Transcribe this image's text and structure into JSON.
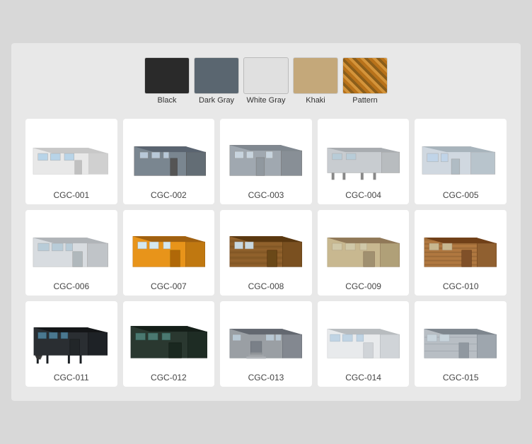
{
  "swatches": [
    {
      "id": "black",
      "label": "Black",
      "class": "c-black"
    },
    {
      "id": "dark-gray",
      "label": "Dark Gray",
      "class": "c-darkgray"
    },
    {
      "id": "white-gray",
      "label": "White Gray",
      "class": "c-whitegray"
    },
    {
      "id": "khaki",
      "label": "Khaki",
      "class": "c-khaki"
    },
    {
      "id": "pattern",
      "label": "Pattern",
      "class": "c-pattern"
    }
  ],
  "products": [
    {
      "id": "CGC-001",
      "label": "CGC-001",
      "color": "light",
      "style": "wide"
    },
    {
      "id": "CGC-002",
      "label": "CGC-002",
      "color": "gray",
      "style": "corner"
    },
    {
      "id": "CGC-003",
      "label": "CGC-003",
      "color": "gray-medium",
      "style": "corner2"
    },
    {
      "id": "CGC-004",
      "label": "CGC-004",
      "color": "gray-light2",
      "style": "elevated"
    },
    {
      "id": "CGC-005",
      "label": "CGC-005",
      "color": "blue-gray",
      "style": "side"
    },
    {
      "id": "CGC-006",
      "label": "CGC-006",
      "color": "light2",
      "style": "wide2"
    },
    {
      "id": "CGC-007",
      "label": "CGC-007",
      "color": "orange",
      "style": "orange"
    },
    {
      "id": "CGC-008",
      "label": "CGC-008",
      "color": "wood",
      "style": "wood"
    },
    {
      "id": "CGC-009",
      "label": "CGC-009",
      "color": "tan",
      "style": "tan"
    },
    {
      "id": "CGC-010",
      "label": "CGC-010",
      "color": "brown",
      "style": "brown"
    },
    {
      "id": "CGC-011",
      "label": "CGC-011",
      "color": "dark",
      "style": "dark"
    },
    {
      "id": "CGC-012",
      "label": "CGC-012",
      "color": "dark-green",
      "style": "dark-green"
    },
    {
      "id": "CGC-013",
      "label": "CGC-013",
      "color": "gray2",
      "style": "stairs"
    },
    {
      "id": "CGC-014",
      "label": "CGC-014",
      "color": "white2",
      "style": "white2"
    },
    {
      "id": "CGC-015",
      "label": "CGC-015",
      "color": "silver",
      "style": "silver"
    }
  ]
}
